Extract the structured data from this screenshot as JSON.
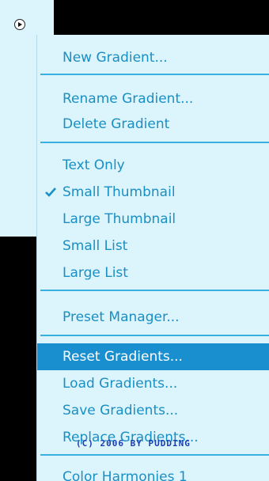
{
  "menu": {
    "items": [
      {
        "label": "New Gradient..."
      },
      {
        "label": "Rename Gradient..."
      },
      {
        "label": "Delete Gradient"
      },
      {
        "label": "Text Only"
      },
      {
        "label": "Small Thumbnail",
        "checked": true
      },
      {
        "label": "Large Thumbnail"
      },
      {
        "label": "Small List"
      },
      {
        "label": "Large List"
      },
      {
        "label": "Preset Manager..."
      },
      {
        "label": "Reset Gradients...",
        "highlighted": true
      },
      {
        "label": "Load Gradients..."
      },
      {
        "label": "Save Gradients..."
      },
      {
        "label": "Replace Gradients..."
      },
      {
        "label": "Color Harmonies 1"
      }
    ]
  },
  "watermark": "(C) 2006 BY PUDDING",
  "colors": {
    "menu_bg": "#dcf4fc",
    "text": "#1a8fc4",
    "highlight_bg": "#1a8fd0",
    "highlight_text": "#ffffff",
    "separator": "#38b0e0",
    "watermark": "#1a3fb0"
  },
  "icons": {
    "flyout_button": "play-arrow-circle-icon",
    "check": "checkmark-icon"
  }
}
